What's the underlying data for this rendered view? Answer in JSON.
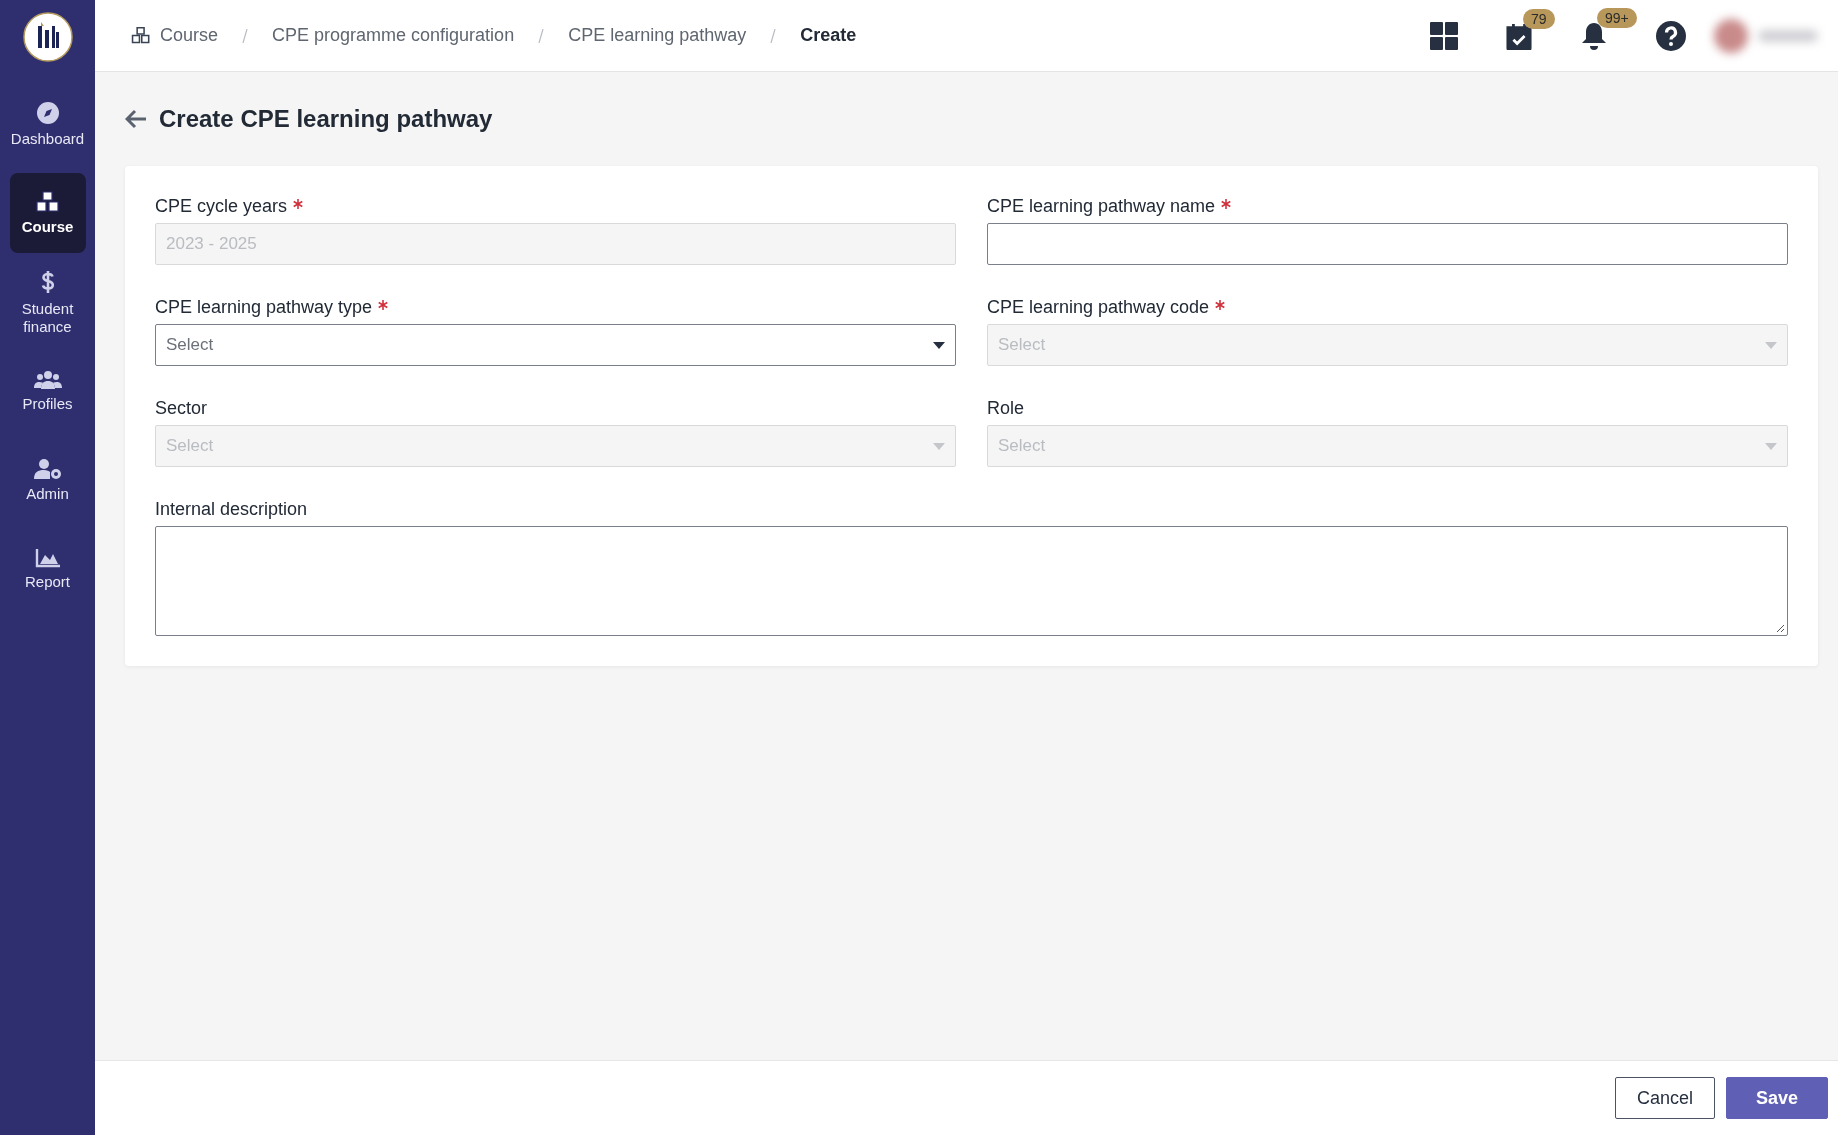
{
  "sidebar": {
    "items": [
      {
        "label": "Dashboard",
        "kind": "compass",
        "selected": false
      },
      {
        "label": "Course",
        "kind": "cubes",
        "selected": true
      },
      {
        "label": "Student finance",
        "kind": "dollar",
        "selected": false
      },
      {
        "label": "Profiles",
        "kind": "users",
        "selected": false
      },
      {
        "label": "Admin",
        "kind": "user-gear",
        "selected": false
      },
      {
        "label": "Report",
        "kind": "chart",
        "selected": false
      }
    ]
  },
  "breadcrumb": [
    {
      "label": "Course",
      "current": false
    },
    {
      "label": "CPE programme configuration",
      "current": false
    },
    {
      "label": "CPE learning pathway",
      "current": false
    },
    {
      "label": "Create",
      "current": true
    }
  ],
  "header_icons": [
    {
      "kind": "grid"
    },
    {
      "kind": "calendar",
      "badge": "79"
    },
    {
      "kind": "bell",
      "badge": "99+"
    },
    {
      "kind": "help"
    }
  ],
  "page_title": "Create CPE learning pathway",
  "form": {
    "fields": [
      {
        "label": "CPE cycle years",
        "required": true,
        "kind": "text",
        "value": "2023 - 2025",
        "disabled": true
      },
      {
        "label": "CPE learning pathway name",
        "required": true,
        "kind": "text",
        "disabled": false
      },
      {
        "label": "CPE learning pathway type",
        "required": true,
        "kind": "select",
        "placeholder": "Select",
        "disabled": false
      },
      {
        "label": "CPE learning pathway code",
        "required": true,
        "kind": "select",
        "placeholder": "Select",
        "disabled": true
      },
      {
        "label": "Sector",
        "required": false,
        "kind": "select",
        "placeholder": "Select",
        "disabled": true
      },
      {
        "label": "Role",
        "required": false,
        "kind": "select",
        "placeholder": "Select",
        "disabled": true
      },
      {
        "label": "Internal description",
        "required": false,
        "kind": "textarea",
        "disabled": false
      }
    ]
  },
  "buttons": [
    {
      "label": "Cancel",
      "kind": "secondary"
    },
    {
      "label": "Save",
      "kind": "primary"
    }
  ]
}
